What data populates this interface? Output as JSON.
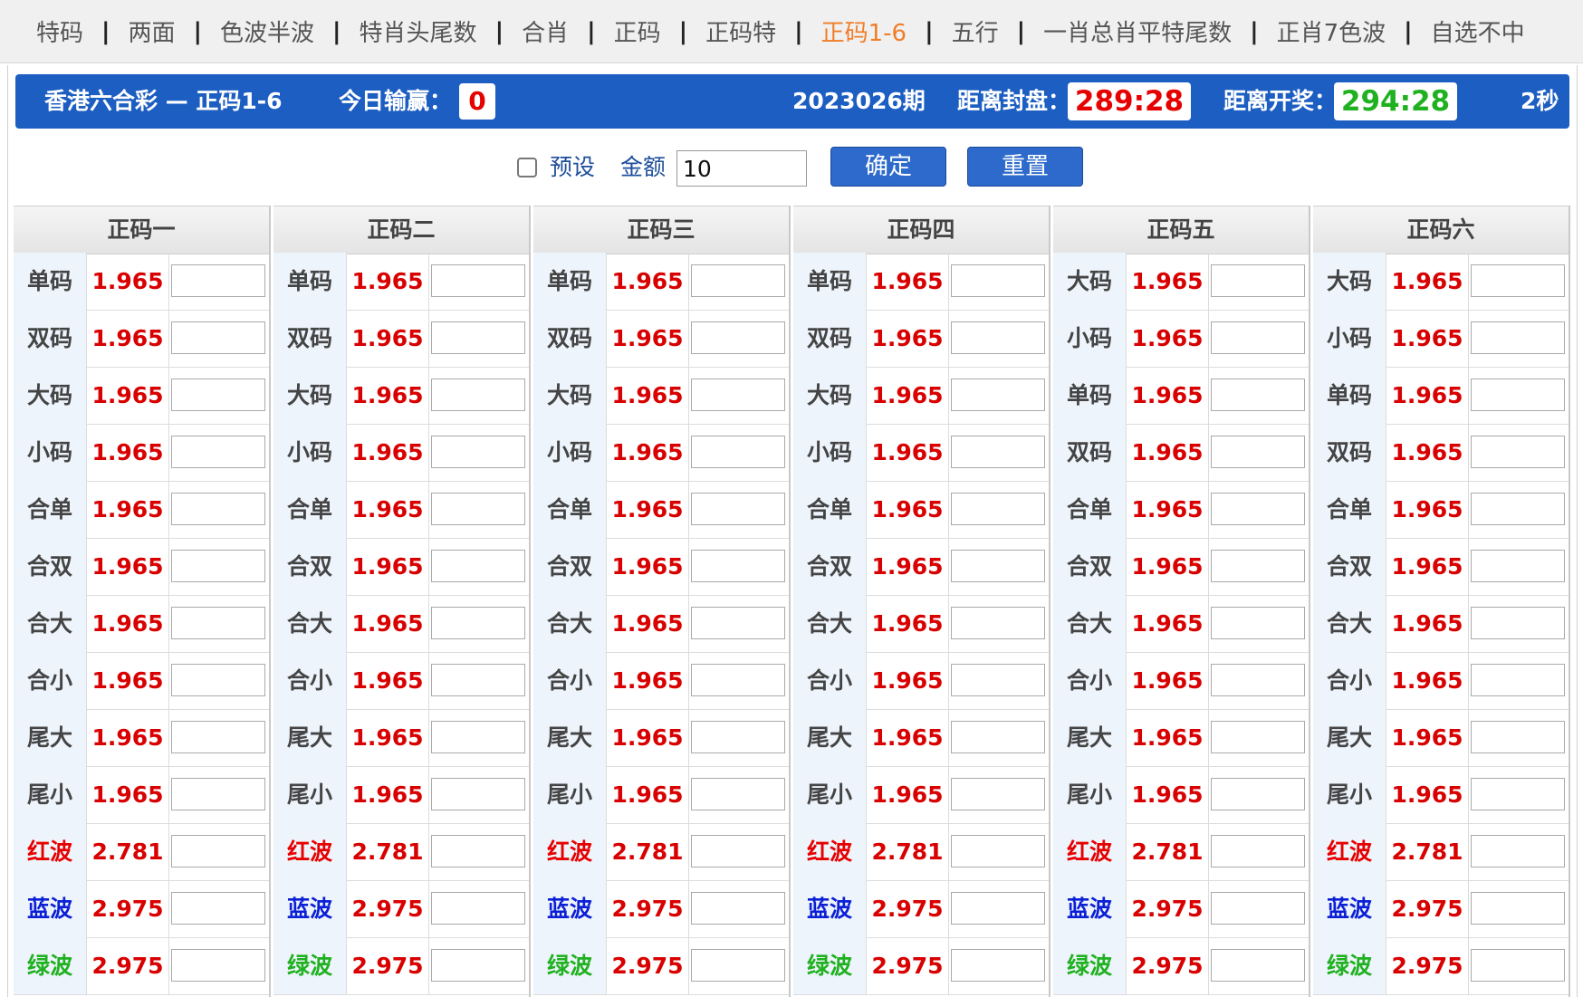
{
  "nav": {
    "items": [
      "特码",
      "两面",
      "色波半波",
      "特肖头尾数",
      "合肖",
      "正码",
      "正码特",
      "正码1-6",
      "五行",
      "一肖总肖平特尾数",
      "正肖7色波",
      "自选不中"
    ],
    "active_index": 7,
    "separator": "|"
  },
  "header": {
    "title": "香港六合彩 — 正码1-6",
    "profit_label": "今日输赢：",
    "profit_value": "0",
    "period": "2023026期",
    "close_label": "距离封盘：",
    "close_time": "289:28",
    "open_label": "距离开奖：",
    "open_time": "294:28",
    "refresh": "2秒"
  },
  "controls": {
    "preset_label": "预设",
    "amount_label": "金额",
    "amount_value": "10",
    "confirm_label": "确定",
    "reset_label": "重置"
  },
  "colors": {
    "header_bg": "#1d5ec2",
    "odds_red": "#d80000",
    "blue_wave": "#0b1fd6",
    "green_wave": "#1fb11f",
    "active_nav": "#f07d28"
  },
  "columns": [
    {
      "title": "正码一",
      "rows": [
        {
          "name": "单码",
          "odds": "1.965"
        },
        {
          "name": "双码",
          "odds": "1.965"
        },
        {
          "name": "大码",
          "odds": "1.965"
        },
        {
          "name": "小码",
          "odds": "1.965"
        },
        {
          "name": "合单",
          "odds": "1.965"
        },
        {
          "name": "合双",
          "odds": "1.965"
        },
        {
          "name": "合大",
          "odds": "1.965"
        },
        {
          "name": "合小",
          "odds": "1.965"
        },
        {
          "name": "尾大",
          "odds": "1.965"
        },
        {
          "name": "尾小",
          "odds": "1.965"
        },
        {
          "name": "红波",
          "odds": "2.781",
          "color": "red"
        },
        {
          "name": "蓝波",
          "odds": "2.975",
          "color": "blue"
        },
        {
          "name": "绿波",
          "odds": "2.975",
          "color": "green"
        }
      ]
    },
    {
      "title": "正码二",
      "rows": [
        {
          "name": "单码",
          "odds": "1.965"
        },
        {
          "name": "双码",
          "odds": "1.965"
        },
        {
          "name": "大码",
          "odds": "1.965"
        },
        {
          "name": "小码",
          "odds": "1.965"
        },
        {
          "name": "合单",
          "odds": "1.965"
        },
        {
          "name": "合双",
          "odds": "1.965"
        },
        {
          "name": "合大",
          "odds": "1.965"
        },
        {
          "name": "合小",
          "odds": "1.965"
        },
        {
          "name": "尾大",
          "odds": "1.965"
        },
        {
          "name": "尾小",
          "odds": "1.965"
        },
        {
          "name": "红波",
          "odds": "2.781",
          "color": "red"
        },
        {
          "name": "蓝波",
          "odds": "2.975",
          "color": "blue"
        },
        {
          "name": "绿波",
          "odds": "2.975",
          "color": "green"
        }
      ]
    },
    {
      "title": "正码三",
      "rows": [
        {
          "name": "单码",
          "odds": "1.965"
        },
        {
          "name": "双码",
          "odds": "1.965"
        },
        {
          "name": "大码",
          "odds": "1.965"
        },
        {
          "name": "小码",
          "odds": "1.965"
        },
        {
          "name": "合单",
          "odds": "1.965"
        },
        {
          "name": "合双",
          "odds": "1.965"
        },
        {
          "name": "合大",
          "odds": "1.965"
        },
        {
          "name": "合小",
          "odds": "1.965"
        },
        {
          "name": "尾大",
          "odds": "1.965"
        },
        {
          "name": "尾小",
          "odds": "1.965"
        },
        {
          "name": "红波",
          "odds": "2.781",
          "color": "red"
        },
        {
          "name": "蓝波",
          "odds": "2.975",
          "color": "blue"
        },
        {
          "name": "绿波",
          "odds": "2.975",
          "color": "green"
        }
      ]
    },
    {
      "title": "正码四",
      "rows": [
        {
          "name": "单码",
          "odds": "1.965"
        },
        {
          "name": "双码",
          "odds": "1.965"
        },
        {
          "name": "大码",
          "odds": "1.965"
        },
        {
          "name": "小码",
          "odds": "1.965"
        },
        {
          "name": "合单",
          "odds": "1.965"
        },
        {
          "name": "合双",
          "odds": "1.965"
        },
        {
          "name": "合大",
          "odds": "1.965"
        },
        {
          "name": "合小",
          "odds": "1.965"
        },
        {
          "name": "尾大",
          "odds": "1.965"
        },
        {
          "name": "尾小",
          "odds": "1.965"
        },
        {
          "name": "红波",
          "odds": "2.781",
          "color": "red"
        },
        {
          "name": "蓝波",
          "odds": "2.975",
          "color": "blue"
        },
        {
          "name": "绿波",
          "odds": "2.975",
          "color": "green"
        }
      ]
    },
    {
      "title": "正码五",
      "rows": [
        {
          "name": "大码",
          "odds": "1.965"
        },
        {
          "name": "小码",
          "odds": "1.965"
        },
        {
          "name": "单码",
          "odds": "1.965"
        },
        {
          "name": "双码",
          "odds": "1.965"
        },
        {
          "name": "合单",
          "odds": "1.965"
        },
        {
          "name": "合双",
          "odds": "1.965"
        },
        {
          "name": "合大",
          "odds": "1.965"
        },
        {
          "name": "合小",
          "odds": "1.965"
        },
        {
          "name": "尾大",
          "odds": "1.965"
        },
        {
          "name": "尾小",
          "odds": "1.965"
        },
        {
          "name": "红波",
          "odds": "2.781",
          "color": "red"
        },
        {
          "name": "蓝波",
          "odds": "2.975",
          "color": "blue"
        },
        {
          "name": "绿波",
          "odds": "2.975",
          "color": "green"
        }
      ]
    },
    {
      "title": "正码六",
      "rows": [
        {
          "name": "大码",
          "odds": "1.965"
        },
        {
          "name": "小码",
          "odds": "1.965"
        },
        {
          "name": "单码",
          "odds": "1.965"
        },
        {
          "name": "双码",
          "odds": "1.965"
        },
        {
          "name": "合单",
          "odds": "1.965"
        },
        {
          "name": "合双",
          "odds": "1.965"
        },
        {
          "name": "合大",
          "odds": "1.965"
        },
        {
          "name": "合小",
          "odds": "1.965"
        },
        {
          "name": "尾大",
          "odds": "1.965"
        },
        {
          "name": "尾小",
          "odds": "1.965"
        },
        {
          "name": "红波",
          "odds": "2.781",
          "color": "red"
        },
        {
          "name": "蓝波",
          "odds": "2.975",
          "color": "blue"
        },
        {
          "name": "绿波",
          "odds": "2.975",
          "color": "green"
        }
      ]
    }
  ]
}
